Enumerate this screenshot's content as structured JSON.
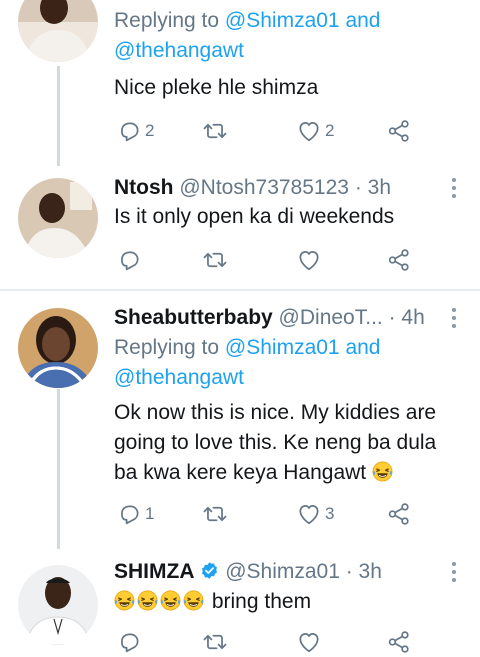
{
  "tweets": [
    {
      "replying_prefix": "Replying to ",
      "replying_user1": "@Shimza01",
      "replying_and": " and",
      "replying_user2": "@thehangawt",
      "text": "Nice pleke hle shimza",
      "reply_count": "2",
      "like_count": "2"
    },
    {
      "name": "Ntosh",
      "handle": "@Ntosh73785123",
      "time": "· 3h",
      "text": "Is it only open ka di weekends"
    },
    {
      "name": "Sheabutterbaby",
      "handle": "@DineoT...",
      "time": "· 4h",
      "replying_prefix": "Replying to ",
      "replying_user1": "@Shimza01",
      "replying_and": " and",
      "replying_user2": "@thehangawt",
      "text_line1": "Ok now this is nice. My kiddies are",
      "text_line2": "going to love this. Ke neng ba dula",
      "text_line3": "ba kwa kere keya Hangawt",
      "reply_count": "1",
      "like_count": "3"
    },
    {
      "name": "SHIMZA",
      "handle": "@Shimza01",
      "time": "· 3h",
      "text": "bring them"
    }
  ],
  "icons": {
    "reply": "reply-icon",
    "retweet": "retweet-icon",
    "like": "heart-icon",
    "share": "share-icon",
    "emoji": "face-with-tears-of-joy-icon",
    "verified": "verified-badge-icon"
  },
  "colors": {
    "link": "#1da1f2",
    "muted": "#657786",
    "divider": "#e6ecf0",
    "thread": "#cfd9de",
    "verified": "#1da1f2"
  }
}
